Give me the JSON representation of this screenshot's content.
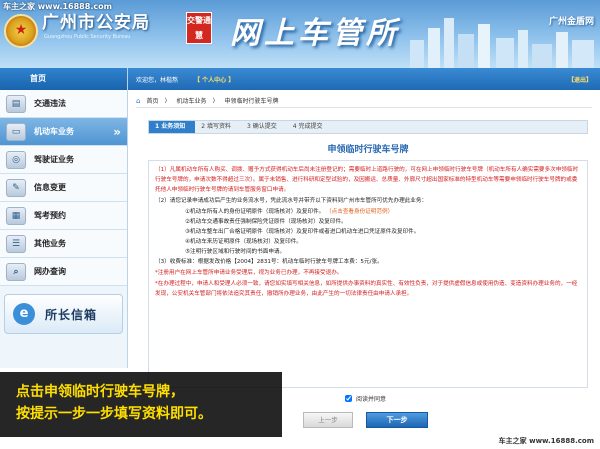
{
  "watermark_top": "车主之家 www.16888.com",
  "header": {
    "bureau_name": "广州市公安局",
    "bureau_en": "Guangzhou Public Security Bureau",
    "traffic_badge": "交警通慧",
    "site_title": "网上车管所",
    "gz_gov": "广州金盾网"
  },
  "sidebar": {
    "home": "首页",
    "items": [
      {
        "label": "交通违法",
        "icon": "document-icon"
      },
      {
        "label": "机动车业务",
        "icon": "car-card-icon"
      },
      {
        "label": "驾驶证业务",
        "icon": "steering-wheel-icon"
      },
      {
        "label": "信息变更",
        "icon": "info-change-icon"
      },
      {
        "label": "驾考预约",
        "icon": "exam-booking-icon"
      },
      {
        "label": "其他业务",
        "icon": "other-services-icon"
      },
      {
        "label": "网办查询",
        "icon": "online-query-icon"
      }
    ],
    "director_mail": "所长信箱"
  },
  "topbar": {
    "welcome": "欢迎您，林楷熬",
    "user_center": "【 个人中心 】",
    "logout": "【退出】"
  },
  "breadcrumb": [
    "首页",
    "机动车业务",
    "申领临时行驶车号牌"
  ],
  "steps": [
    "1 业务须知",
    "2 填写资料",
    "3 确认提交",
    "4 完成提交"
  ],
  "content": {
    "title": "申领临时行驶车号牌",
    "p1": "（1）凡属机动车所有人购买、调拨、赠予方式获得机动车后尚未注册登记的；需要临时上道路行驶的，可在网上申领临时行驶车号牌（机动车所有人确实需要多次申领临时行驶车号牌的，申请次数不得超过三次）。属于未销售、进行科研和定型试验的，及因搬运、总质量、外廓尺寸超出国家标准的特型机动车等需要申领临时行驶车号牌的或委托他人申领临时行驶车号牌的请到车管服务窗口申请。",
    "p2": "（2）请您记录申请成功后产生的业务流水号，凭此流水号并带齐以下资料到广州市车管所可优先办理此业务：",
    "p2_items": [
      "①机动车所有人的身份证明原件（现场核对）及复印件。",
      "②机动车交通事故责任强制保险凭证原件（现场核对）及复印件。",
      "③机动车整车出厂合格证明原件（现场核对）及复印件或者进口机动车进口凭证原件及复印件。",
      "④机动车来历证明原件（现场核对）及复印件。",
      "⑤注明行驶区域和行驶时间的书面申请。"
    ],
    "link_text": "（点击查看身份证明范例）",
    "p3": "（3）收费标准：根据发改价格【2004】2831号：机动车临时行驶车号牌工本费：5元/张。",
    "notice1": "*注册用户在网上车管所申请业务受理后，视为业务已办理，不再接受退办。",
    "notice2": "*在办理过程中，申请人和受理人必须一致，请您如实填写相关信息，如所提供办事资料的真实性、有效性负责，对于提供虚假信息或使用伪造、变造资料办理业务的，一经发现，公安机关车管部门将依法追究其责任，撤销所办理业务，由此产生的一切法律责任由申请人承担。"
  },
  "agree_label": "阅读并同意",
  "buttons": {
    "prev": "上一步",
    "next": "下一步"
  },
  "caption": {
    "line1": "点击申领临时行驶车号牌，",
    "line2": "按提示一步一步填写资料即可。"
  },
  "bottom_watermark": "车主之家 www.16888.com"
}
